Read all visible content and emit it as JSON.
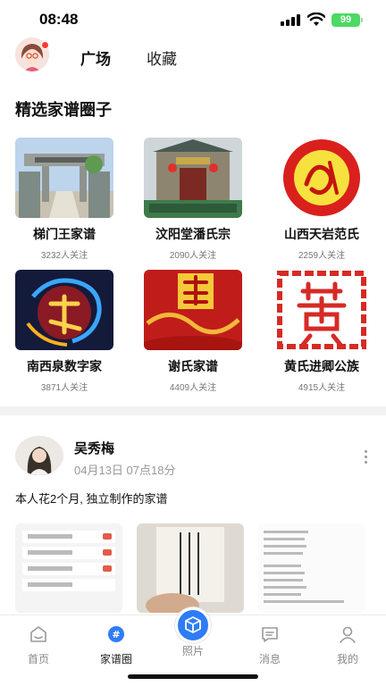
{
  "status_bar": {
    "time": "08:48",
    "battery": "99"
  },
  "header": {
    "tabs": [
      {
        "label": "广场",
        "active": true
      },
      {
        "label": "收藏",
        "active": false
      }
    ]
  },
  "section": {
    "title": "精选家谱圈子"
  },
  "circles": [
    {
      "name": "梯门王家谱",
      "followers": "3232人关注"
    },
    {
      "name": "汶阳堂潘氏宗",
      "followers": "2090人关注"
    },
    {
      "name": "山西天岩范氏",
      "followers": "2259人关注"
    },
    {
      "name": "南西泉数字家",
      "followers": "3871人关注"
    },
    {
      "name": "谢氏家谱",
      "followers": "4409人关注"
    },
    {
      "name": "黄氏进卿公族",
      "followers": "4915人关注"
    }
  ],
  "post": {
    "author": "吴秀梅",
    "time": "04月13日 07点18分",
    "text": "本人花2个月, 独立制作的家谱"
  },
  "bottom_nav": {
    "items": [
      {
        "label": "首页",
        "icon": "home-icon",
        "active": false
      },
      {
        "label": "家谱圈",
        "icon": "genealogy-circle-icon",
        "active": true
      },
      {
        "label": "照片",
        "icon": "cube-icon",
        "active": false
      },
      {
        "label": "消息",
        "icon": "message-icon",
        "active": false
      },
      {
        "label": "我的",
        "icon": "user-icon",
        "active": false
      }
    ]
  },
  "colors": {
    "accent": "#2f7cf6",
    "battery": "#4cd964",
    "badge": "#ff3b30"
  }
}
